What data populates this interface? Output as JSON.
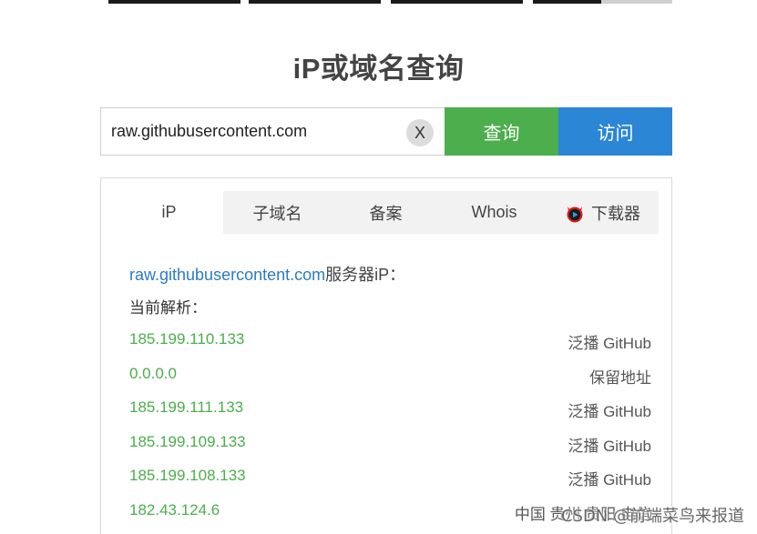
{
  "page": {
    "title": "iP或域名查询"
  },
  "search": {
    "value": "raw.githubusercontent.com",
    "clear_label": "X",
    "query_label": "查询",
    "visit_label": "访问"
  },
  "tabs": [
    {
      "label": "iP",
      "active": true
    },
    {
      "label": "子域名",
      "active": false
    },
    {
      "label": "备案",
      "active": false
    },
    {
      "label": "Whois",
      "active": false
    },
    {
      "label": "下载器",
      "active": false,
      "icon": "devil-play-icon"
    }
  ],
  "result": {
    "domain": "raw.githubusercontent.com",
    "title_suffix": "服务器iP：",
    "parse_label": "当前解析：",
    "rows": [
      {
        "ip": "185.199.110.133",
        "location": "泛播 GitHub"
      },
      {
        "ip": "0.0.0.0",
        "location": "保留地址"
      },
      {
        "ip": "185.199.111.133",
        "location": "泛播 GitHub"
      },
      {
        "ip": "185.199.109.133",
        "location": "泛播 GitHub"
      },
      {
        "ip": "185.199.108.133",
        "location": "泛播 GitHub"
      },
      {
        "ip": "182.43.124.6",
        "location": "中国 贵州 贵阳 电信"
      }
    ]
  },
  "watermark": "CSDN @前端菜鸟来报道",
  "colors": {
    "query_button": "#4cae4c",
    "visit_button": "#2b86d6",
    "ip_text": "#4cae4c",
    "domain_link": "#2b7bc4"
  }
}
